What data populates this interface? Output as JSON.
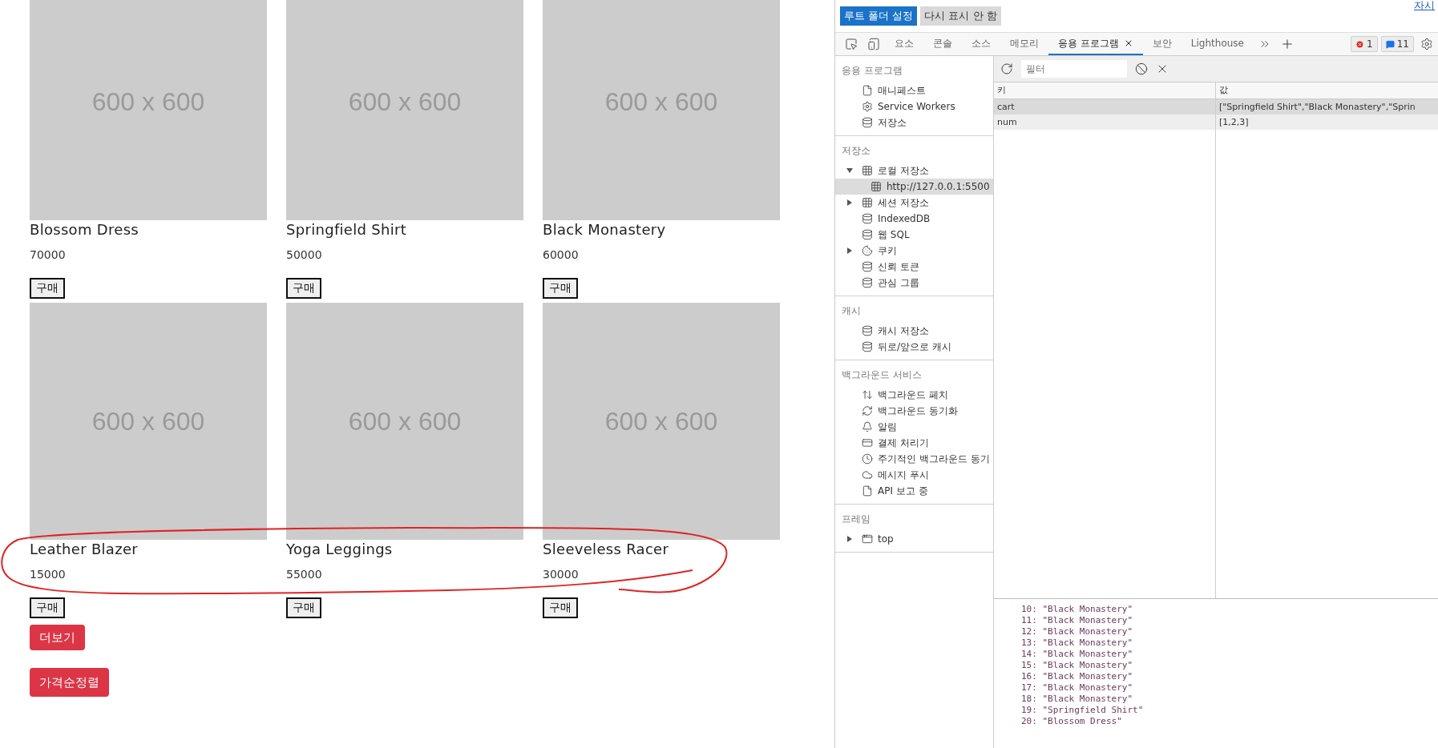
{
  "shop": {
    "products": [
      {
        "name": "Blossom Dress",
        "price": "70000",
        "image_label": "600 x 600",
        "buy": "구매"
      },
      {
        "name": "Springfield Shirt",
        "price": "50000",
        "image_label": "600 x 600",
        "buy": "구매"
      },
      {
        "name": "Black Monastery",
        "price": "60000",
        "image_label": "600 x 600",
        "buy": "구매"
      },
      {
        "name": "Leather Blazer",
        "price": "15000",
        "image_label": "600 x 600",
        "buy": "구매"
      },
      {
        "name": "Yoga Leggings",
        "price": "55000",
        "image_label": "600 x 600",
        "buy": "구매"
      },
      {
        "name": "Sleeveless Racer",
        "price": "30000",
        "image_label": "600 x 600",
        "buy": "구매"
      }
    ],
    "actions": [
      {
        "label": "더보기"
      },
      {
        "label": "가격순정렬"
      }
    ]
  },
  "devtools": {
    "notice": {
      "buttons": [
        {
          "label": "루트 폴더 설정",
          "kind": "primary"
        },
        {
          "label": "다시 표시 안 함",
          "kind": "secondary"
        }
      ],
      "link": "자시"
    },
    "tabs": [
      {
        "label": "요소",
        "selected": false,
        "closable": false
      },
      {
        "label": "콘솔",
        "selected": false,
        "closable": false
      },
      {
        "label": "소스",
        "selected": false,
        "closable": false
      },
      {
        "label": "메모리",
        "selected": false,
        "closable": false
      },
      {
        "label": "응용 프로그램",
        "selected": true,
        "closable": true
      },
      {
        "label": "보안",
        "selected": false,
        "closable": false
      },
      {
        "label": "Lighthouse",
        "selected": false,
        "closable": false
      }
    ],
    "badges": [
      {
        "kind": "error",
        "count": "1"
      },
      {
        "kind": "info",
        "count": "11"
      }
    ],
    "sidebar": [
      {
        "title": "응용 프로그램",
        "items": [
          {
            "label": "매니페스트",
            "kind": "file",
            "selected": false
          },
          {
            "label": "Service Workers",
            "kind": "gear",
            "selected": false
          },
          {
            "label": "저장소",
            "kind": "database",
            "selected": false
          }
        ]
      },
      {
        "title": "저장소",
        "items": [
          {
            "label": "로컬 저장소",
            "kind": "grid",
            "selected": false,
            "expanded": true,
            "children": [
              {
                "label": "http://127.0.0.1:5500",
                "kind": "grid",
                "selected": true
              }
            ]
          },
          {
            "label": "세션 저장소",
            "kind": "grid",
            "selected": false,
            "expanded": false
          },
          {
            "label": "IndexedDB",
            "kind": "database",
            "selected": false
          },
          {
            "label": "웹 SQL",
            "kind": "database",
            "selected": false
          },
          {
            "label": "쿠키",
            "kind": "cookie",
            "selected": false,
            "expanded": false
          },
          {
            "label": "신뢰 토큰",
            "kind": "database",
            "selected": false
          },
          {
            "label": "관심 그룹",
            "kind": "database",
            "selected": false
          }
        ]
      },
      {
        "title": "캐시",
        "items": [
          {
            "label": "캐시 저장소",
            "kind": "database",
            "selected": false
          },
          {
            "label": "뒤로/앞으로 캐시",
            "kind": "database",
            "selected": false
          }
        ]
      },
      {
        "title": "백그라운드 서비스",
        "items": [
          {
            "label": "백그라운드 페치",
            "kind": "arrows",
            "selected": false
          },
          {
            "label": "백그라운드 동기화",
            "kind": "sync",
            "selected": false
          },
          {
            "label": "알림",
            "kind": "bell",
            "selected": false
          },
          {
            "label": "결제 처리기",
            "kind": "card",
            "selected": false
          },
          {
            "label": "주기적인 백그라운드 동기",
            "kind": "clock",
            "selected": false
          },
          {
            "label": "메시지 푸시",
            "kind": "cloud",
            "selected": false
          },
          {
            "label": "API 보고 중",
            "kind": "file",
            "selected": false
          }
        ]
      },
      {
        "title": "프레임",
        "items": [
          {
            "label": "top",
            "kind": "window",
            "selected": false,
            "expanded": false
          }
        ]
      }
    ],
    "storage": {
      "filter": {
        "placeholder": "필터"
      },
      "columns": [
        "키",
        "값"
      ],
      "rows": [
        {
          "key": "cart",
          "value": "[\"Springfield Shirt\",\"Black Monastery\",\"Sprin",
          "selected": true
        },
        {
          "key": "num",
          "value": "[1,2,3]",
          "selected": false
        }
      ]
    },
    "console": [
      {
        "index": "10:",
        "value": "\"Black Monastery\""
      },
      {
        "index": "11:",
        "value": "\"Black Monastery\""
      },
      {
        "index": "12:",
        "value": "\"Black Monastery\""
      },
      {
        "index": "13:",
        "value": "\"Black Monastery\""
      },
      {
        "index": "14:",
        "value": "\"Black Monastery\""
      },
      {
        "index": "15:",
        "value": "\"Black Monastery\""
      },
      {
        "index": "16:",
        "value": "\"Black Monastery\""
      },
      {
        "index": "17:",
        "value": "\"Black Monastery\""
      },
      {
        "index": "18:",
        "value": "\"Black Monastery\""
      },
      {
        "index": "19:",
        "value": "\"Springfield Shirt\""
      },
      {
        "index": "20:",
        "value": "\"Blossom Dress\""
      }
    ]
  }
}
